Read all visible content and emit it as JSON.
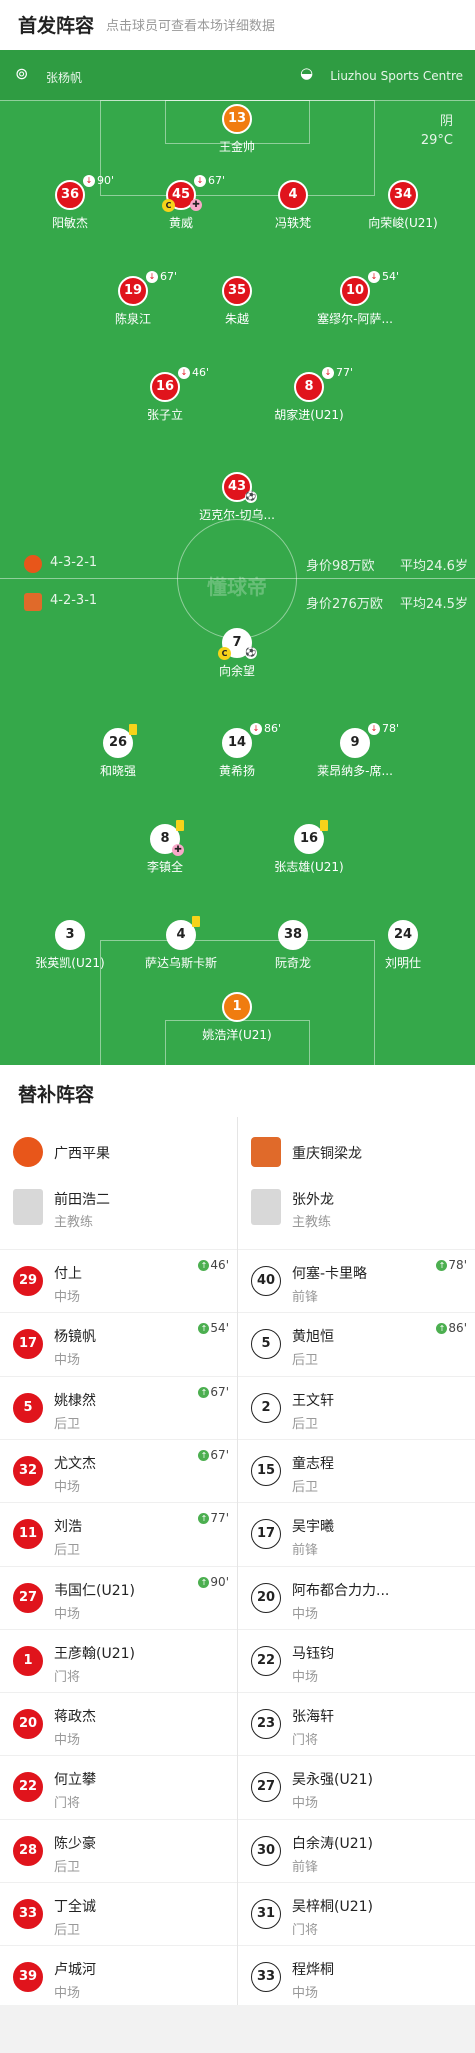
{
  "header": {
    "title": "首发阵容",
    "subtitle": "点击球员可查看本场详细数据"
  },
  "infobar": {
    "referee": "张杨帆",
    "venue": "Liuzhou Sports Centre"
  },
  "weather": {
    "condition": "阴",
    "temperature": "29°C"
  },
  "watermark": "懂球帝",
  "home_band": {
    "formation": "4-3-2-1",
    "value": "身价98万欧",
    "age": "平均24.6岁"
  },
  "away_band": {
    "formation": "4-2-3-1",
    "value": "身价276万欧",
    "age": "平均24.5岁"
  },
  "home_players": [
    {
      "number": "13",
      "name": "王金帅",
      "gk": true
    },
    {
      "number": "36",
      "name": "阳敏杰",
      "sub": "90'"
    },
    {
      "number": "45",
      "name": "黄威",
      "sub": "67'",
      "captain": "C"
    },
    {
      "number": "4",
      "name": "冯轶梵"
    },
    {
      "number": "34",
      "name": "向荣峻(U21)"
    },
    {
      "number": "19",
      "name": "陈泉江",
      "sub": "67'"
    },
    {
      "number": "35",
      "name": "朱越"
    },
    {
      "number": "10",
      "name": "塞缪尔-阿萨...",
      "sub": "54'"
    },
    {
      "number": "16",
      "name": "张子立",
      "sub": "46'"
    },
    {
      "number": "8",
      "name": "胡家进(U21)",
      "sub": "77'"
    },
    {
      "number": "43",
      "name": "迈克尔-切乌..."
    }
  ],
  "away_players": [
    {
      "number": "7",
      "name": "向余望",
      "captain": "C"
    },
    {
      "number": "26",
      "name": "和晓强"
    },
    {
      "number": "14",
      "name": "黄希扬",
      "sub": "86'"
    },
    {
      "number": "9",
      "name": "莱昂纳多-席...",
      "sub": "78'"
    },
    {
      "number": "8",
      "name": "李镇全"
    },
    {
      "number": "16",
      "name": "张志雄(U21)"
    },
    {
      "number": "3",
      "name": "张英凯(U21)"
    },
    {
      "number": "4",
      "name": "萨达乌斯卡斯"
    },
    {
      "number": "38",
      "name": "阮奇龙"
    },
    {
      "number": "24",
      "name": "刘明仕"
    },
    {
      "number": "1",
      "name": "姚浩洋(U21)",
      "gk": true
    }
  ],
  "subs": {
    "title": "替补阵容",
    "home_team": "广西平果",
    "away_team": "重庆铜梁龙",
    "home_coach": {
      "name": "前田浩二",
      "role": "主教练"
    },
    "away_coach": {
      "name": "张外龙",
      "role": "主教练"
    },
    "home_list": [
      {
        "number": "29",
        "name": "付上",
        "position": "中场",
        "in": "46'"
      },
      {
        "number": "17",
        "name": "杨镜帆",
        "position": "中场",
        "in": "54'"
      },
      {
        "number": "5",
        "name": "姚棣然",
        "position": "后卫",
        "in": "67'"
      },
      {
        "number": "32",
        "name": "尤文杰",
        "position": "中场",
        "in": "67'"
      },
      {
        "number": "11",
        "name": "刘浩",
        "position": "后卫",
        "in": "77'"
      },
      {
        "number": "27",
        "name": "韦国仁(U21)",
        "position": "中场",
        "in": "90'"
      },
      {
        "number": "1",
        "name": "王彦翰(U21)",
        "position": "门将"
      },
      {
        "number": "20",
        "name": "蒋政杰",
        "position": "中场"
      },
      {
        "number": "22",
        "name": "何立攀",
        "position": "门将"
      },
      {
        "number": "28",
        "name": "陈少豪",
        "position": "后卫"
      },
      {
        "number": "33",
        "name": "丁全诚",
        "position": "后卫"
      },
      {
        "number": "39",
        "name": "卢城河",
        "position": "中场"
      }
    ],
    "away_list": [
      {
        "number": "40",
        "name": "何塞-卡里略",
        "position": "前锋",
        "in": "78'"
      },
      {
        "number": "5",
        "name": "黄旭恒",
        "position": "后卫",
        "in": "86'"
      },
      {
        "number": "2",
        "name": "王文轩",
        "position": "后卫"
      },
      {
        "number": "15",
        "name": "童志程",
        "position": "后卫"
      },
      {
        "number": "17",
        "name": "吴宇曦",
        "position": "前锋"
      },
      {
        "number": "20",
        "name": "阿布都合力力...",
        "position": "中场"
      },
      {
        "number": "22",
        "name": "马钰钧",
        "position": "中场"
      },
      {
        "number": "23",
        "name": "张海轩",
        "position": "门将"
      },
      {
        "number": "27",
        "name": "吴永强(U21)",
        "position": "中场"
      },
      {
        "number": "30",
        "name": "白余涛(U21)",
        "position": "前锋"
      },
      {
        "number": "31",
        "name": "吴梓桐(U21)",
        "position": "门将"
      },
      {
        "number": "33",
        "name": "程烨桐",
        "position": "中场"
      }
    ]
  },
  "colors": {
    "pitch": "#35a84a",
    "home": "#e0141c",
    "keeper": "#f07c10",
    "sub_in": "#4caf50"
  }
}
